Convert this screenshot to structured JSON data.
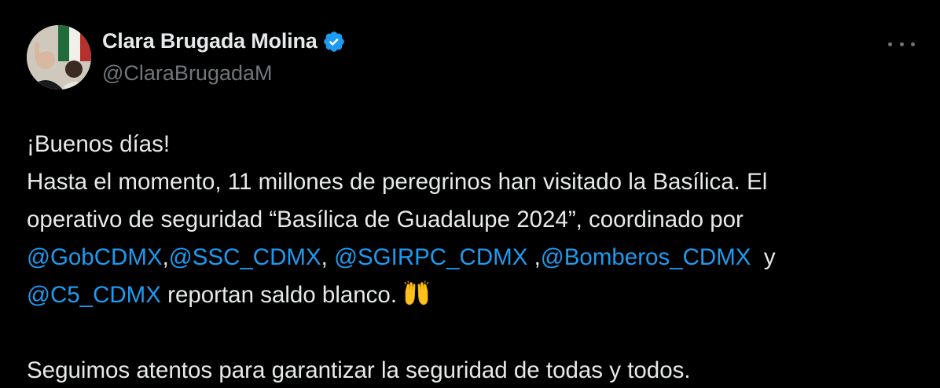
{
  "author": {
    "display_name": "Clara Brugada Molina",
    "handle": "@ClaraBrugadaM",
    "verified": true
  },
  "icons": {
    "verified": "verified-badge-icon",
    "more": "more-options-icon",
    "emoji": "raising-hands-emoji"
  },
  "colors": {
    "background": "#000000",
    "text": "#e7e9ea",
    "secondary_text": "#71767b",
    "link": "#1d9bf0",
    "verified": "#1d9bf0"
  },
  "tweet": {
    "line1": "¡Buenos días!",
    "line2": "Hasta el momento, 11 millones de peregrinos han visitado la Basílica. El",
    "line3": "operativo de seguridad “Basílica de Guadalupe 2024”, coordinado por",
    "mention1": "@GobCDMX",
    "sep1": ",",
    "mention2": "@SSC_CDMX",
    "sep2": ", ",
    "mention3": "@SGIRPC_CDMX",
    "sep3": " ,",
    "mention4": "@Bomberos_CDMX",
    "sep4": "  y",
    "mention5": "@C5_CDMX",
    "line5_text": " reportan saldo blanco.",
    "line6": "Seguimos atentos para garantizar la seguridad de todas y todos."
  }
}
